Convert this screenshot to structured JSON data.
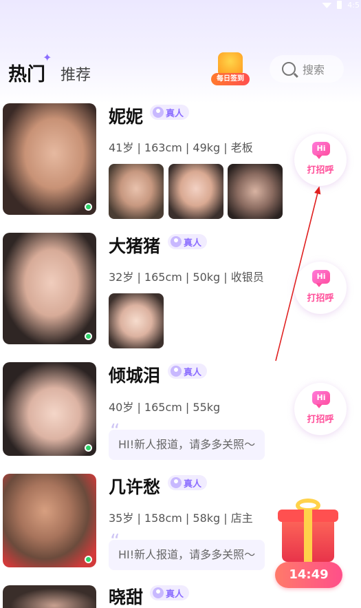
{
  "status_bar": {
    "time": "4:5"
  },
  "header": {
    "tabs": [
      {
        "label": "热门",
        "active": true
      },
      {
        "label": "推荐",
        "active": false
      }
    ],
    "signin": {
      "label": "每日签到"
    },
    "search": {
      "placeholder": "搜索"
    }
  },
  "users": [
    {
      "name": "妮妮",
      "badge": "真人",
      "info": "41岁 | 163cm | 49kg | 老板",
      "photos": 3,
      "quote": ""
    },
    {
      "name": "大猪猪",
      "badge": "真人",
      "info": "32岁 | 165cm | 50kg | 收银员",
      "photos": 1,
      "quote": ""
    },
    {
      "name": "倾城泪",
      "badge": "真人",
      "info": "40岁 | 165cm | 55kg",
      "photos": 0,
      "quote": "HI!新人报道，请多多关照～"
    },
    {
      "name": "几许愁",
      "badge": "真人",
      "info": "35岁 | 158cm | 58kg | 店主",
      "photos": 0,
      "quote": "HI!新人报道，请多多关照～"
    },
    {
      "name": "晓甜",
      "badge": "真人",
      "info": "",
      "photos": 0,
      "quote": ""
    }
  ],
  "greet": {
    "hi": "Hi",
    "label": "打招呼"
  },
  "gift": {
    "countdown": "14:49"
  },
  "colors": {
    "accent": "#8a6cff",
    "greet": "#ff4f9a",
    "online": "#2ed36a"
  }
}
